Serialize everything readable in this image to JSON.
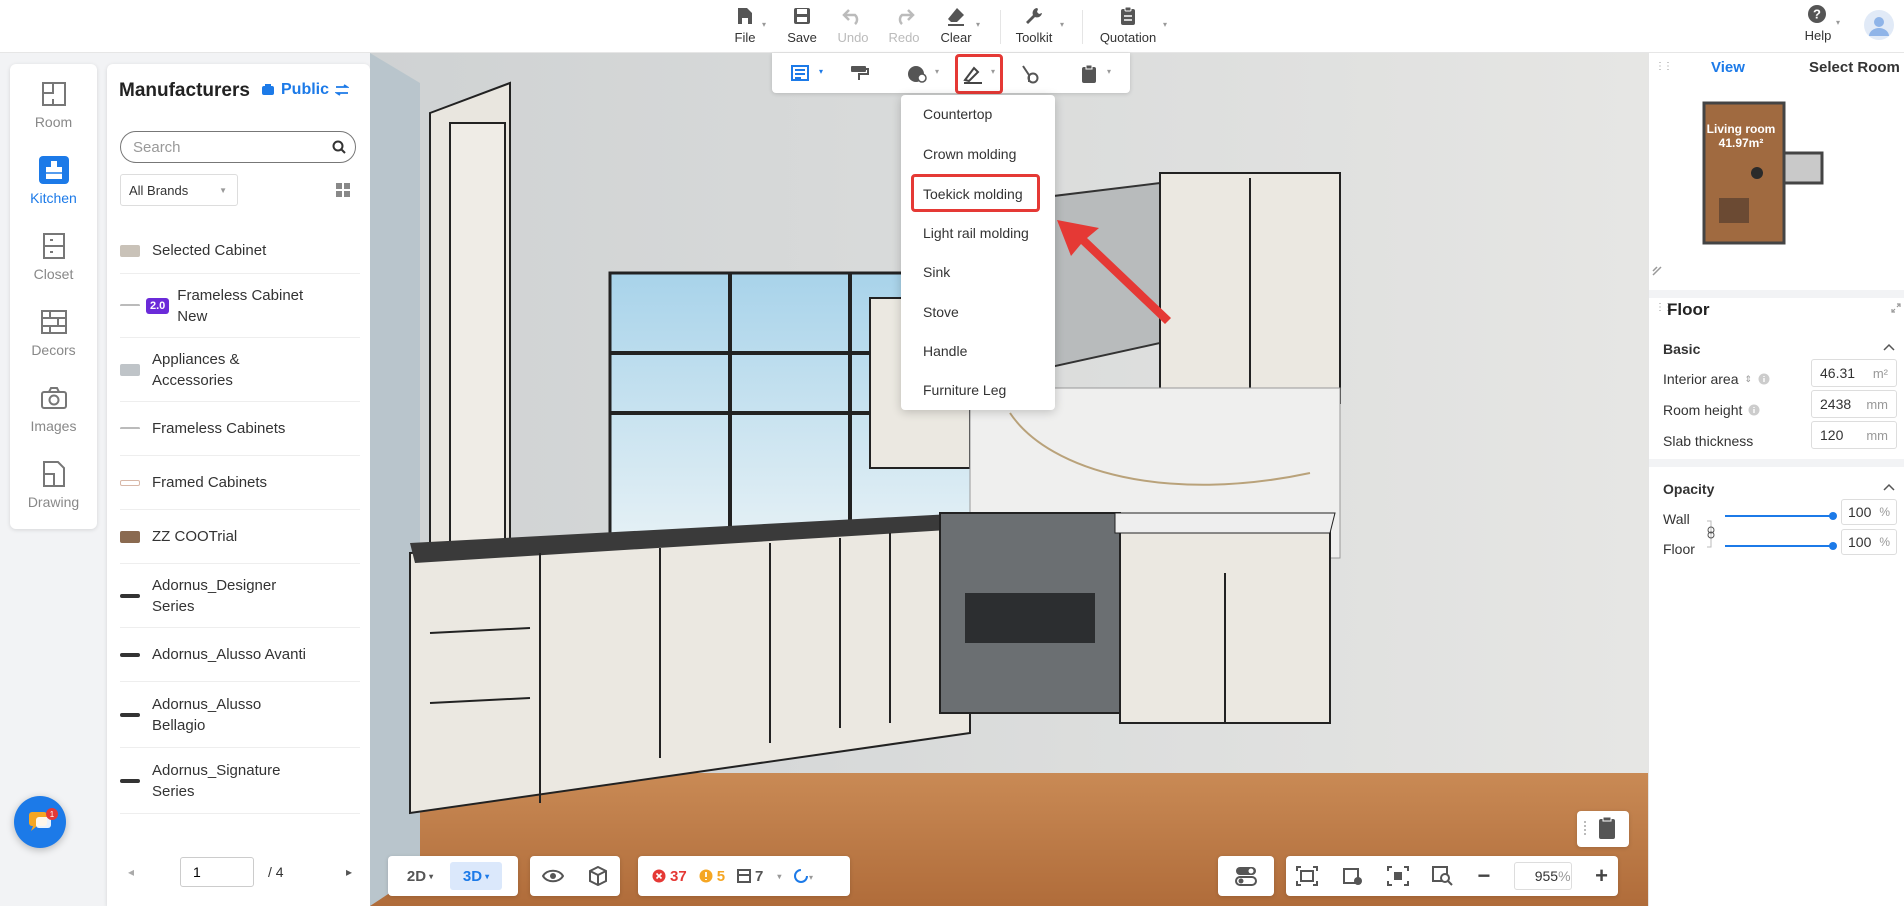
{
  "toolbar": {
    "file": "File",
    "save": "Save",
    "undo": "Undo",
    "redo": "Redo",
    "clear": "Clear",
    "toolkit": "Toolkit",
    "quotation": "Quotation",
    "help": "Help"
  },
  "rail": {
    "items": [
      {
        "label": "Room",
        "icon": "room-icon"
      },
      {
        "label": "Kitchen",
        "icon": "kitchen-icon"
      },
      {
        "label": "Closet",
        "icon": "closet-icon"
      },
      {
        "label": "Decors",
        "icon": "decors-icon"
      },
      {
        "label": "Images",
        "icon": "camera-icon"
      },
      {
        "label": "Drawing",
        "icon": "drawing-icon"
      }
    ],
    "active": "Kitchen"
  },
  "manufacturers": {
    "title": "Manufacturers",
    "scope": "Public",
    "search_placeholder": "Search",
    "brand_filter": "All Brands",
    "items": [
      {
        "label": "Selected Cabinet"
      },
      {
        "label": "Frameless Cabinet New",
        "badge": "2.0"
      },
      {
        "label": "Appliances & Accessories"
      },
      {
        "label": "Frameless Cabinets"
      },
      {
        "label": "Framed Cabinets"
      },
      {
        "label": "ZZ COOTrial"
      },
      {
        "label": "Adornus_Designer Series"
      },
      {
        "label": "Adornus_Alusso Avanti"
      },
      {
        "label": "Adornus_Alusso Bellagio"
      },
      {
        "label": "Adornus_Signature Series"
      }
    ],
    "pager": {
      "page": "1",
      "total": "/ 4"
    }
  },
  "dropdown": {
    "items": [
      "Countertop",
      "Crown molding",
      "Toekick molding",
      "Light rail molding",
      "Sink",
      "Stove",
      "Handle",
      "Furniture Leg"
    ],
    "selected": "Toekick molding"
  },
  "viewbar": {
    "mode_2d": "2D",
    "mode_3d": "3D",
    "errors": "37",
    "warnings": "5",
    "items": "7",
    "zoom": "955",
    "zoom_unit": "%"
  },
  "right_panel": {
    "tabs": [
      "View",
      "Select Room"
    ],
    "active_tab": "View",
    "minimap_label": "Living room",
    "minimap_area": "41.97m²",
    "floor_title": "Floor",
    "basic_title": "Basic",
    "interior_area_label": "Interior area",
    "interior_area_value": "46.31",
    "interior_area_unit": "m²",
    "room_height_label": "Room height",
    "room_height_value": "2438",
    "room_height_unit": "mm",
    "slab_label": "Slab thickness",
    "slab_value": "120",
    "slab_unit": "mm",
    "opacity_title": "Opacity",
    "wall_label": "Wall",
    "wall_value": "100",
    "floor_label": "Floor",
    "floor_value": "100",
    "percent": "%"
  },
  "chat": {
    "badge": "1"
  },
  "colors": {
    "accent": "#1c7ae8",
    "highlight": "#e53935"
  }
}
